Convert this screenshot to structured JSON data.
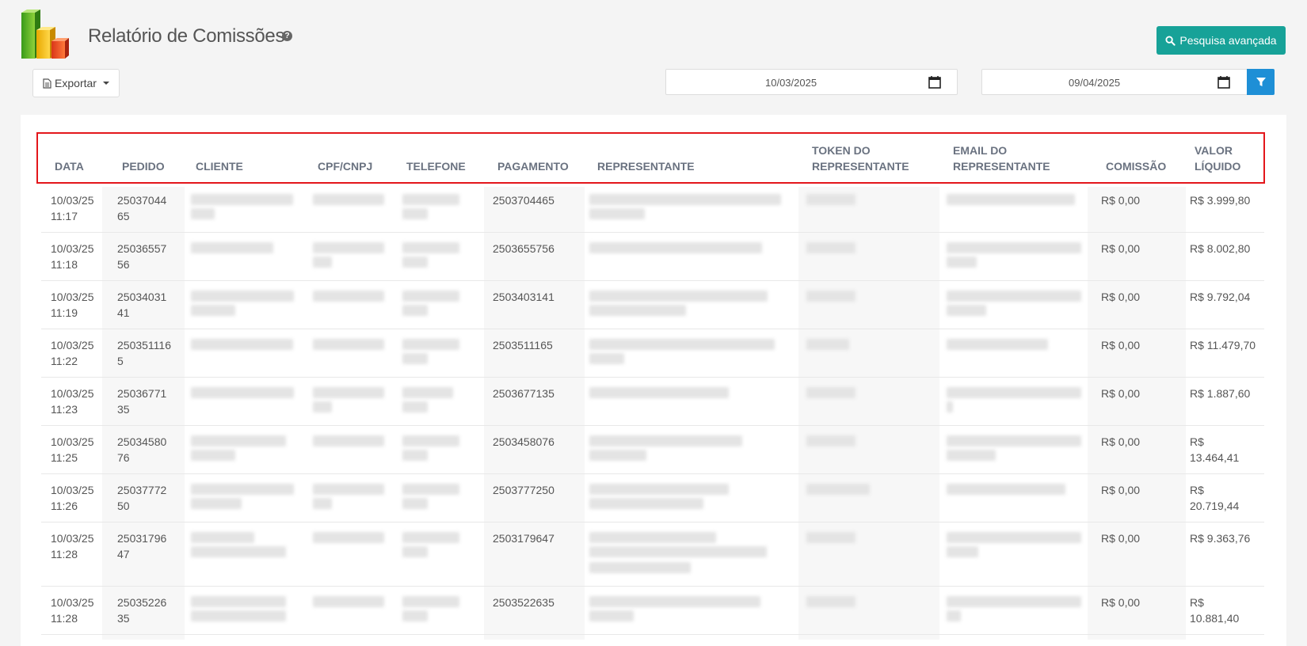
{
  "header": {
    "title": "Relatório de Comissões",
    "help": "?",
    "advanced_search_label": "Pesquisa avançada",
    "export_label": "Exportar",
    "date_from": "10/03/2025",
    "date_to": "09/04/2025"
  },
  "colors": {
    "accent_teal": "#17a298",
    "filter_blue": "#1e8fd6",
    "highlight_red": "#e3161b"
  },
  "table": {
    "columns": {
      "data": "DATA",
      "pedido": "PEDIDO",
      "cliente": "CLIENTE",
      "cpf": "CPF/CNPJ",
      "telefone": "TELEFONE",
      "pagamento": "PAGAMENTO",
      "representante": "REPRESENTANTE",
      "token_1": "TOKEN DO",
      "token_2": "REPRESENTANTE",
      "email_1": "EMAIL DO",
      "email_2": "REPRESENTANTE",
      "comissao": "COMISSÃO",
      "valor_1": "VALOR",
      "valor_2": "LÍQUIDO"
    },
    "rows": [
      {
        "date": "10/03/25",
        "time": "11:17",
        "pedido_1": "25037044",
        "pedido_2": "65",
        "pagamento": "2503704465",
        "comissao": "R$ 0,00",
        "valor_1": "R$ 3.999,80",
        "valor_2": ""
      },
      {
        "date": "10/03/25",
        "time": "11:18",
        "pedido_1": "25036557",
        "pedido_2": "56",
        "pagamento": "2503655756",
        "comissao": "R$ 0,00",
        "valor_1": "R$ 8.002,80",
        "valor_2": ""
      },
      {
        "date": "10/03/25",
        "time": "11:19",
        "pedido_1": "25034031",
        "pedido_2": "41",
        "pagamento": "2503403141",
        "comissao": "R$ 0,00",
        "valor_1": "R$ 9.792,04",
        "valor_2": ""
      },
      {
        "date": "10/03/25",
        "time": "11:22",
        "pedido_1": "250351116",
        "pedido_2": "5",
        "pagamento": "2503511165",
        "comissao": "R$ 0,00",
        "valor_1": "R$ 11.479,70",
        "valor_2": ""
      },
      {
        "date": "10/03/25",
        "time": "11:23",
        "pedido_1": "25036771",
        "pedido_2": "35",
        "pagamento": "2503677135",
        "comissao": "R$ 0,00",
        "valor_1": "R$ 1.887,60",
        "valor_2": ""
      },
      {
        "date": "10/03/25",
        "time": "11:25",
        "pedido_1": "25034580",
        "pedido_2": "76",
        "pagamento": "2503458076",
        "comissao": "R$ 0,00",
        "valor_1": "R$",
        "valor_2": "13.464,41"
      },
      {
        "date": "10/03/25",
        "time": "11:26",
        "pedido_1": "25037772",
        "pedido_2": "50",
        "pagamento": "2503777250",
        "comissao": "R$ 0,00",
        "valor_1": "R$",
        "valor_2": "20.719,44"
      },
      {
        "date": "10/03/25",
        "time": "11:28",
        "pedido_1": "25031796",
        "pedido_2": "47",
        "pagamento": "2503179647",
        "comissao": "R$ 0,00",
        "valor_1": "R$ 9.363,76",
        "valor_2": ""
      },
      {
        "date": "10/03/25",
        "time": "11:28",
        "pedido_1": "25035226",
        "pedido_2": "35",
        "pagamento": "2503522635",
        "comissao": "R$ 0,00",
        "valor_1": "R$",
        "valor_2": "10.881,40"
      }
    ]
  }
}
